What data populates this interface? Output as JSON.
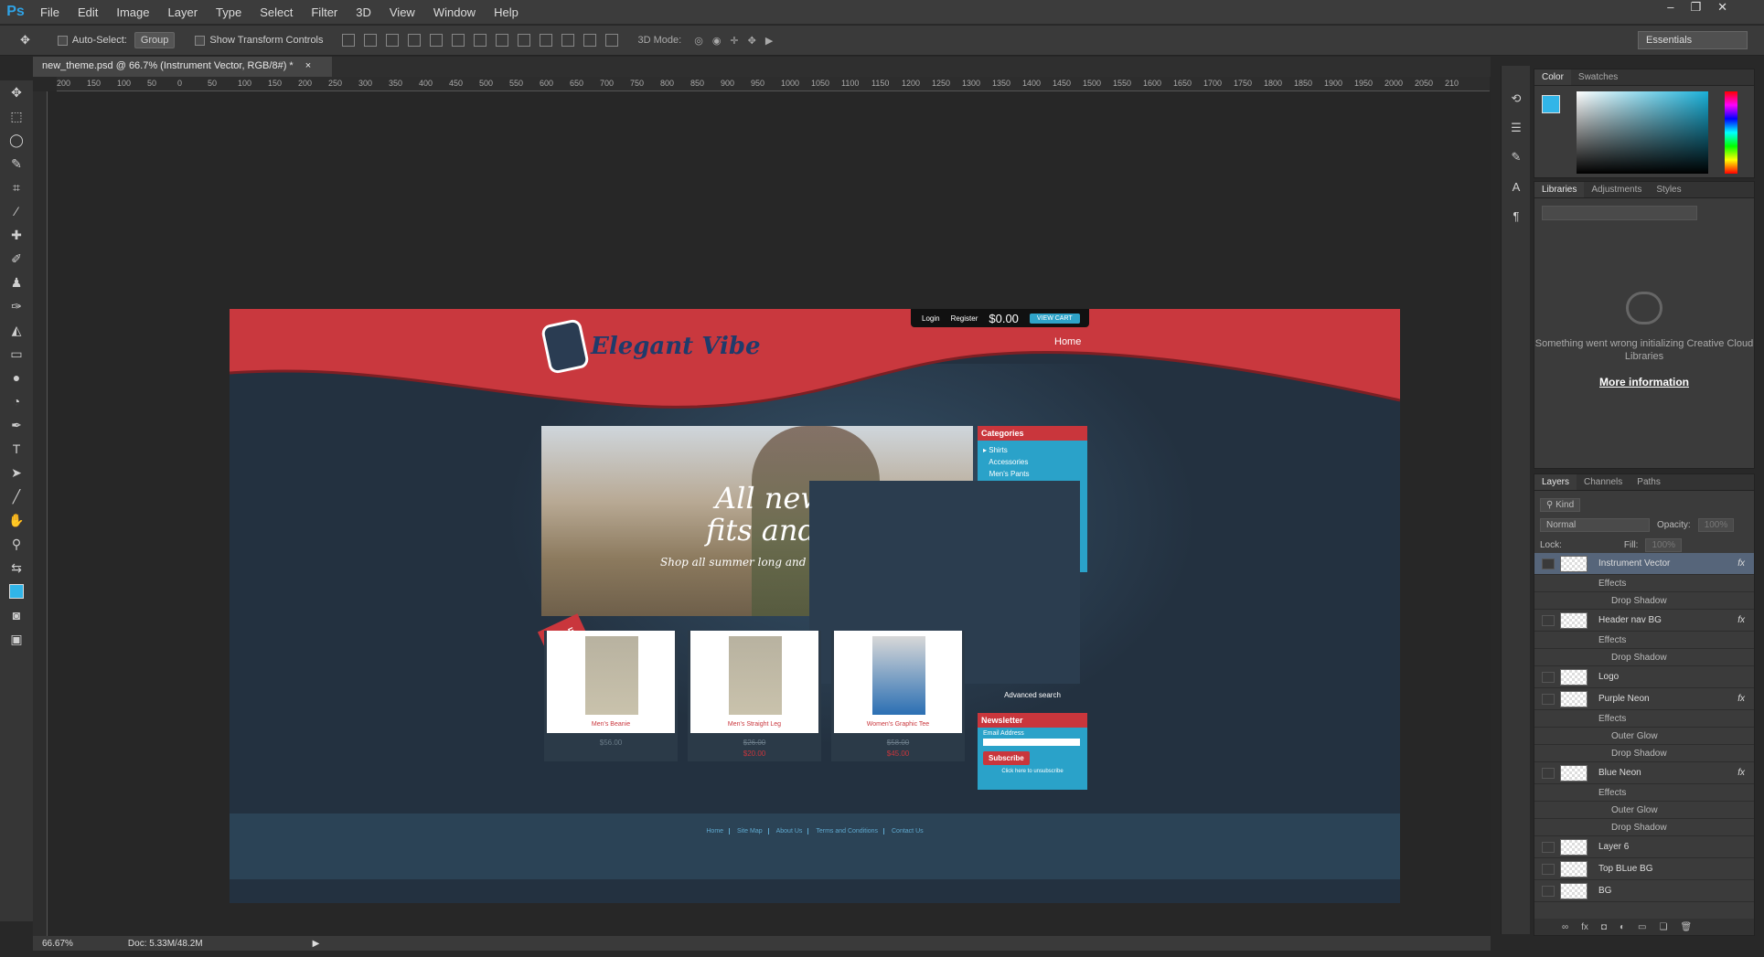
{
  "app": {
    "logo": "Ps",
    "menu": [
      "File",
      "Edit",
      "Image",
      "Layer",
      "Type",
      "Select",
      "Filter",
      "3D",
      "View",
      "Window",
      "Help"
    ],
    "window_controls": [
      "–",
      "❐",
      "✕"
    ]
  },
  "options": {
    "auto_select": "Auto-Select:",
    "group": "Group",
    "show_transform": "Show Transform Controls",
    "mode_3d": "3D Mode:",
    "workspace": "Essentials"
  },
  "document": {
    "tab_title": "new_theme.psd @ 66.7% (Instrument Vector, RGB/8#) *",
    "close": "×",
    "zoom": "66.67%",
    "doc_size": "Doc: 5.33M/48.2M"
  },
  "ruler": {
    "h_ticks": [
      "200",
      "150",
      "100",
      "50",
      "0",
      "50",
      "100",
      "150",
      "200",
      "250",
      "300",
      "350",
      "400",
      "450",
      "500",
      "550",
      "600",
      "650",
      "700",
      "750",
      "800",
      "850",
      "900",
      "950",
      "1000",
      "1050",
      "1100",
      "1150",
      "1200",
      "1250",
      "1300",
      "1350",
      "1400",
      "1450",
      "1500",
      "1550",
      "1600",
      "1650",
      "1700",
      "1750",
      "1800",
      "1850",
      "1900",
      "1950",
      "2000",
      "2050",
      "210"
    ]
  },
  "design": {
    "logo_text": "Elegant Vibe",
    "login": "Login",
    "register": "Register",
    "cart_total": "$0.00",
    "view_cart": "VIEW CART",
    "nav_home": "Home",
    "hero_line1": "All new",
    "hero_line2": "fits and wa",
    "hero_line3": "Shop all summer long and rece",
    "categories_title": "Categories",
    "categories": [
      "Shirts",
      "Accessories",
      "Men's Pants"
    ],
    "advanced_search": "Advanced search",
    "newsletter_title": "Newsletter",
    "email_label": "Email Address",
    "subscribe": "Subscribe",
    "unsubscribe": "Click here to unsubscribe",
    "sale_badge": "SALE",
    "products": [
      {
        "name": "Men's Beanie",
        "price": "$56.00",
        "sale": ""
      },
      {
        "name": "Men's Straight Leg",
        "price": "$26.00",
        "sale": "$20.00"
      },
      {
        "name": "Women's Graphic Tee",
        "price": "$58.00",
        "sale": "$45.00"
      }
    ],
    "footer_links": [
      "Home",
      "Site Map",
      "About Us",
      "Terms and Conditions",
      "Contact Us"
    ]
  },
  "panels": {
    "color_tabs": [
      "Color",
      "Swatches"
    ],
    "fg_color": "#31b5e8",
    "lib_tabs": [
      "Libraries",
      "Adjustments",
      "Styles"
    ],
    "lib_message": "Something went wrong initializing Creative Cloud Libraries",
    "lib_more": "More information",
    "layer_tabs": [
      "Layers",
      "Channels",
      "Paths"
    ],
    "kind": "Kind",
    "blend": "Normal",
    "opacity_label": "Opacity:",
    "opacity_value": "100%",
    "lock_label": "Lock:",
    "fill_label": "Fill:",
    "fill_value": "100%",
    "layers": [
      {
        "name": "Instrument Vector",
        "fx": "fx",
        "type": "main",
        "selected": true
      },
      {
        "name": "Effects",
        "type": "sub"
      },
      {
        "name": "Drop Shadow",
        "type": "subsub"
      },
      {
        "name": "Header nav BG",
        "fx": "fx",
        "type": "main"
      },
      {
        "name": "Effects",
        "type": "sub"
      },
      {
        "name": "Drop Shadow",
        "type": "subsub"
      },
      {
        "name": "Logo",
        "type": "main"
      },
      {
        "name": "Purple Neon",
        "fx": "fx",
        "type": "main"
      },
      {
        "name": "Effects",
        "type": "sub"
      },
      {
        "name": "Outer Glow",
        "type": "subsub"
      },
      {
        "name": "Drop Shadow",
        "type": "subsub"
      },
      {
        "name": "Blue Neon",
        "fx": "fx",
        "type": "main"
      },
      {
        "name": "Effects",
        "type": "sub"
      },
      {
        "name": "Outer Glow",
        "type": "subsub"
      },
      {
        "name": "Drop Shadow",
        "type": "subsub"
      },
      {
        "name": "Layer 6",
        "type": "main"
      },
      {
        "name": "Top BLue BG",
        "type": "main"
      },
      {
        "name": "BG",
        "type": "main"
      }
    ],
    "footer_icons": [
      "link-icon",
      "fx-icon",
      "mask-icon",
      "adjustment-icon",
      "folder-icon",
      "new-layer-icon",
      "trash-icon"
    ]
  }
}
